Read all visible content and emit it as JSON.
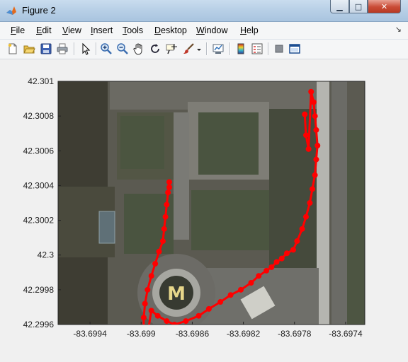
{
  "window": {
    "title": "Figure 2"
  },
  "menu": [
    "File",
    "Edit",
    "View",
    "Insert",
    "Tools",
    "Desktop",
    "Window",
    "Help"
  ],
  "toolbar": {
    "icons": [
      "new-figure-icon",
      "open-file-icon",
      "save-icon",
      "print-icon",
      "pointer-icon",
      "zoom-in-icon",
      "zoom-out-icon",
      "pan-hand-icon",
      "rotate-3d-icon",
      "data-cursor-icon",
      "brush-icon",
      "brush-dropdown-icon",
      "link-plot-icon",
      "colorbar-icon",
      "legend-icon",
      "hide-plot-tools-icon",
      "show-plot-tools-icon"
    ]
  },
  "chart_data": {
    "type": "line",
    "background": "satellite map image",
    "line_color": "#ff0000",
    "marker": "filled circle",
    "xlim": [
      -83.69965,
      -83.69725
    ],
    "ylim": [
      42.2996,
      42.301
    ],
    "xticks": [
      -83.6994,
      -83.699,
      -83.6986,
      -83.6982,
      -83.6978,
      -83.6974
    ],
    "xtick_labels": [
      "-83.6994",
      "-83.699",
      "-83.6986",
      "-83.6982",
      "-83.6978",
      "-83.6974"
    ],
    "yticks": [
      42.2996,
      42.2998,
      42.3,
      42.3002,
      42.3004,
      42.3006,
      42.3008,
      42.301
    ],
    "ytick_labels": [
      "42.2996",
      "42.2998",
      "42.3",
      "42.3002",
      "42.3004",
      "42.3006",
      "42.3008",
      "42.301"
    ],
    "series": [
      {
        "x": [
          -83.69878,
          -83.69878,
          -83.69879,
          -83.6988,
          -83.69881,
          -83.69882,
          -83.69883,
          -83.69886,
          -83.69889,
          -83.69892,
          -83.69895,
          -83.69897,
          -83.69898,
          -83.69898,
          -83.69896,
          -83.69892,
          -83.69887,
          -83.6988,
          -83.69874,
          -83.69865,
          -83.69855,
          -83.69847,
          -83.69838,
          -83.6983,
          -83.69822,
          -83.69814,
          -83.69808,
          -83.69802,
          -83.69798,
          -83.69794,
          -83.6979,
          -83.69786,
          -83.69781,
          -83.69778,
          -83.69774,
          -83.69771,
          -83.69768,
          -83.69766,
          -83.69764,
          -83.69763,
          -83.69762,
          -83.69763,
          -83.69764,
          -83.69765,
          -83.69767,
          -83.69769,
          -83.69771,
          -83.69772
        ],
        "y": [
          42.30042,
          42.30039,
          42.30036,
          42.30029,
          42.30022,
          42.30015,
          42.30008,
          42.30002,
          42.29995,
          42.29988,
          42.2998,
          42.29972,
          42.29964,
          42.29956,
          42.2995,
          42.29968,
          42.29965,
          42.29962,
          42.2996,
          42.29962,
          42.29965,
          42.29969,
          42.29973,
          42.29977,
          42.2998,
          42.29984,
          42.29988,
          42.29991,
          42.29993,
          42.29996,
          42.29998,
          42.30001,
          42.30003,
          42.30008,
          42.30015,
          42.30022,
          42.3003,
          42.30038,
          42.30046,
          42.30055,
          42.30063,
          42.30072,
          42.3008,
          42.30088,
          42.30094,
          42.30061,
          42.30069,
          42.30081
        ]
      }
    ]
  }
}
